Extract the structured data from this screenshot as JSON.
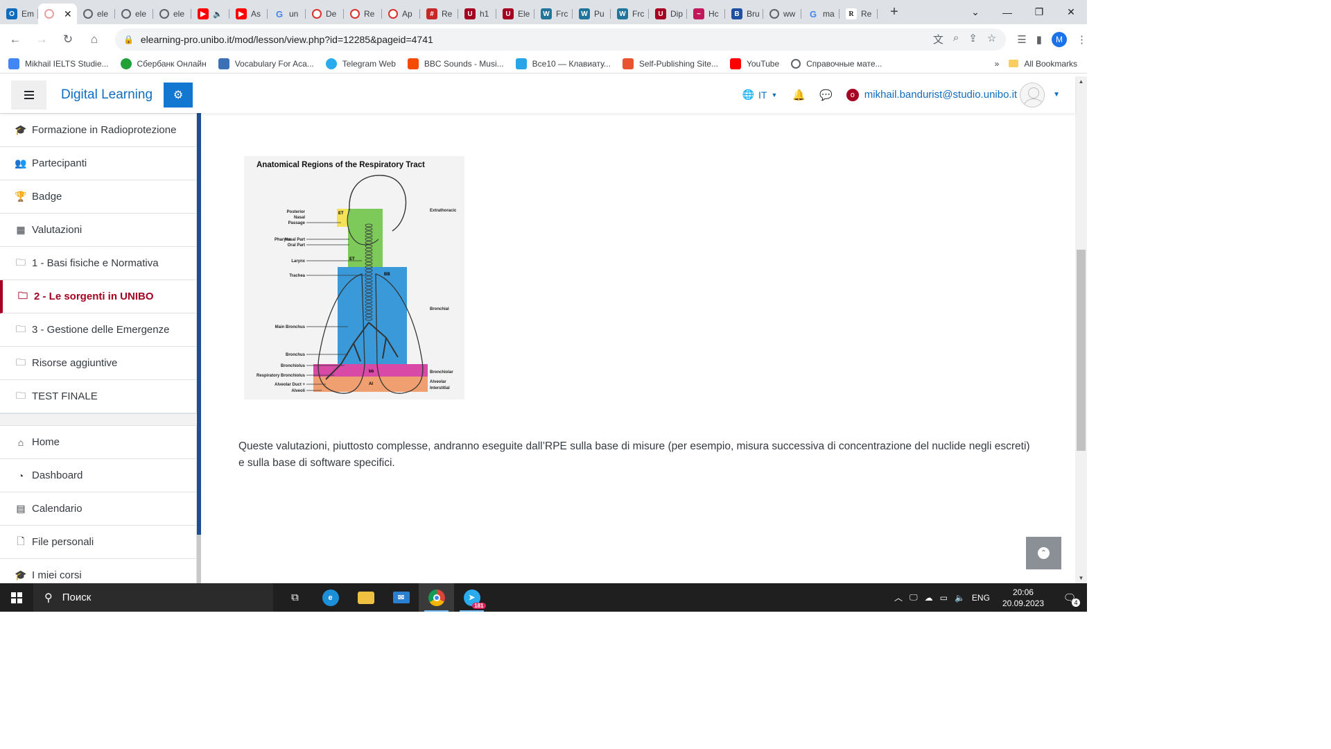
{
  "browser": {
    "tabs": [
      {
        "label": "Em",
        "icon": "outlook-icon",
        "color": "#0f6cbd",
        "glyph": "O"
      },
      {
        "label": "",
        "icon": "unibo-seal-icon",
        "color": "#e8a0a0",
        "glyph": "",
        "active": true
      },
      {
        "label": "ele",
        "icon": "globe-icon",
        "color": "#5f6368",
        "glyph": ""
      },
      {
        "label": "ele",
        "icon": "globe-icon",
        "color": "#5f6368",
        "glyph": ""
      },
      {
        "label": "ele",
        "icon": "globe-icon",
        "color": "#5f6368",
        "glyph": ""
      },
      {
        "label": "",
        "icon": "youtube-icon",
        "color": "#ff0000",
        "glyph": "▶",
        "audio": true
      },
      {
        "label": "As",
        "icon": "youtube-icon",
        "color": "#ff0000",
        "glyph": "▶"
      },
      {
        "label": "un",
        "icon": "google-icon",
        "color": "#4285f4",
        "glyph": "G"
      },
      {
        "label": "De",
        "icon": "unibo-seal-icon",
        "color": "#d9302c",
        "glyph": ""
      },
      {
        "label": "Re",
        "icon": "unibo-seal-icon",
        "color": "#d9302c",
        "glyph": ""
      },
      {
        "label": "Ap",
        "icon": "unibo-seal-icon",
        "color": "#d9302c",
        "glyph": ""
      },
      {
        "label": "Re",
        "icon": "grid-icon",
        "color": "#c62828",
        "glyph": "#"
      },
      {
        "label": "h1",
        "icon": "unibo-u-icon",
        "color": "#a50021",
        "glyph": "U"
      },
      {
        "label": "Ele",
        "icon": "unibo-u-icon",
        "color": "#a50021",
        "glyph": "U"
      },
      {
        "label": "Frc",
        "icon": "wordpress-icon",
        "color": "#21759b",
        "glyph": "W"
      },
      {
        "label": "Pu",
        "icon": "wordpress-icon",
        "color": "#21759b",
        "glyph": "W"
      },
      {
        "label": "Frc",
        "icon": "wordpress-icon",
        "color": "#21759b",
        "glyph": "W"
      },
      {
        "label": "Dip",
        "icon": "unibo-u-icon",
        "color": "#a50021",
        "glyph": "U"
      },
      {
        "label": "Hc",
        "icon": "fire-icon",
        "color": "#c2185b",
        "glyph": "~"
      },
      {
        "label": "Bru",
        "icon": "bruker-icon",
        "color": "#1e4fa0",
        "glyph": "B"
      },
      {
        "label": "ww",
        "icon": "globe-icon",
        "color": "#5f6368",
        "glyph": ""
      },
      {
        "label": "ma",
        "icon": "google-icon",
        "color": "#4285f4",
        "glyph": "G"
      },
      {
        "label": "Re",
        "icon": "researchgate-icon",
        "color": "#ffffff",
        "glyph": "R"
      }
    ],
    "url": "elearning-pro.unibo.it/mod/lesson/view.php?id=12285&pageid=4741",
    "profile_initial": "M",
    "bookmarks": [
      {
        "label": "Mikhail IELTS Studie...",
        "icon": "docs-icon",
        "color": "#4285f4"
      },
      {
        "label": "Сбербанк Онлайн",
        "icon": "sber-icon",
        "color": "#21a038"
      },
      {
        "label": "Vocabulary For Aca...",
        "icon": "ielts-icon",
        "color": "#3b6fb6"
      },
      {
        "label": "Telegram Web",
        "icon": "telegram-icon",
        "color": "#2aabee"
      },
      {
        "label": "BBC Sounds - Musi...",
        "icon": "bbc-sounds-icon",
        "color": "#f54b00"
      },
      {
        "label": "Все10 — Клавиату...",
        "icon": "vse10-icon",
        "color": "#29a4e6"
      },
      {
        "label": "Self-Publishing Site...",
        "icon": "p-icon",
        "color": "#e8542f"
      },
      {
        "label": "YouTube",
        "icon": "youtube-icon",
        "color": "#ff0000"
      },
      {
        "label": "Справочные мате...",
        "icon": "globe-icon",
        "color": "#5f6368"
      }
    ],
    "bookmarks_more": "»",
    "all_bookmarks": "All Bookmarks"
  },
  "moodle": {
    "site_title": "Digital Learning",
    "language": "IT",
    "user_email": "mikhail.bandurist@studio.unibo.it",
    "accent": "#a50021",
    "link_color": "#0f6cbf"
  },
  "sidebar": {
    "course_items": [
      {
        "label": "Formazione in Radioprotezione",
        "icon": "graduation-cap-icon",
        "glyph": "🎓"
      },
      {
        "label": "Partecipanti",
        "icon": "users-icon",
        "glyph": "👥"
      },
      {
        "label": "Badge",
        "icon": "trophy-icon",
        "glyph": "🏆"
      },
      {
        "label": "Valutazioni",
        "icon": "table-icon",
        "glyph": "▦"
      },
      {
        "label": "1 - Basi fisiche e Normativa",
        "icon": "folder-icon",
        "glyph": "🗀"
      },
      {
        "label": "2 - Le sorgenti in UNIBO",
        "icon": "folder-icon",
        "glyph": "🗀",
        "active": true
      },
      {
        "label": "3 - Gestione delle Emergenze",
        "icon": "folder-icon",
        "glyph": "🗀"
      },
      {
        "label": "Risorse aggiuntive",
        "icon": "folder-icon",
        "glyph": "🗀"
      },
      {
        "label": "TEST FINALE",
        "icon": "folder-icon",
        "glyph": "🗀"
      }
    ],
    "site_items": [
      {
        "label": "Home",
        "icon": "home-icon",
        "glyph": "⌂"
      },
      {
        "label": "Dashboard",
        "icon": "dashboard-icon",
        "glyph": "◔"
      },
      {
        "label": "Calendario",
        "icon": "calendar-icon",
        "glyph": "▤"
      },
      {
        "label": "File personali",
        "icon": "file-icon",
        "glyph": "🗋"
      },
      {
        "label": "I miei corsi",
        "icon": "graduation-cap-icon",
        "glyph": "🎓"
      }
    ]
  },
  "content": {
    "cut_off_line": "                                                         (                                                    )",
    "figure": {
      "title": "Anatomical Regions of the Respiratory Tract",
      "left_labels": [
        "Posterior",
        "Nasal",
        "Passage",
        "Pharynx",
        "Nasal Part",
        "Oral Part",
        "Larynx",
        "Trachea",
        "Main Bronchus",
        "Bronchus",
        "Bronchiolus",
        "Respiratory Bronchiolus",
        "Alveolar Duct +",
        "Alveoli"
      ],
      "region_codes": [
        "ET",
        "ET",
        "BB",
        "bb",
        "AI"
      ],
      "right_labels": [
        "Extrathoracic",
        "Bronchial",
        "Bronchiolar",
        "Alveolar",
        "Interstitial"
      ],
      "colors": {
        "et1": "#f3e15a",
        "et2": "#7dc95a",
        "bb": "#3a9ad9",
        "bbsmall": "#d94aa6",
        "ai": "#f0a070"
      }
    },
    "paragraph": "Queste valutazioni, piuttosto complesse, andranno eseguite dall’RPE sulla base di misure (per esempio, misura successiva di concentrazione del nuclide negli escreti) e sulla base di software specifici."
  },
  "taskbar": {
    "search_placeholder": "Поиск",
    "lang": "ENG",
    "time": "20:06",
    "date": "20.09.2023",
    "telegram_badge": "181",
    "notifications": "4"
  }
}
